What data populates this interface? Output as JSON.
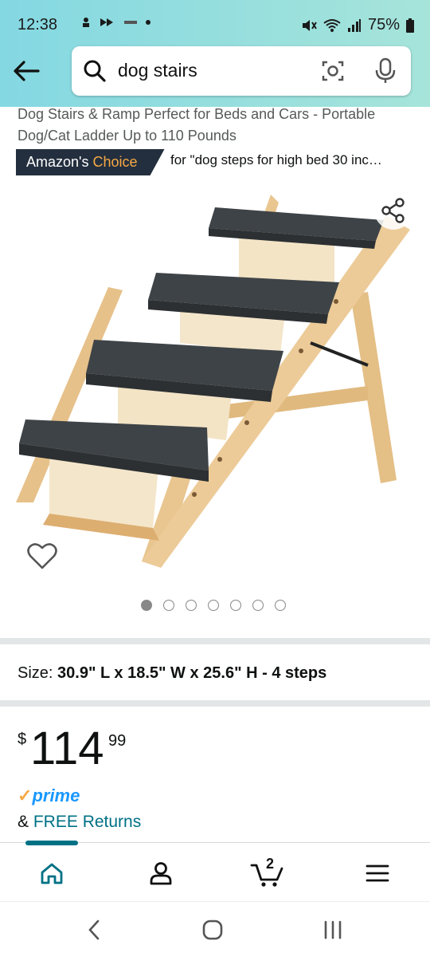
{
  "status_bar": {
    "time": "12:38",
    "battery": "75%"
  },
  "search": {
    "query": "dog stairs"
  },
  "product": {
    "title": "Dog Stairs & Ramp Perfect for Beds and Cars - Portable Dog/Cat Ladder Up to 110 Pounds",
    "badge_prefix": "Amazon's",
    "badge_suffix": "Choice",
    "badge_for": "for \"dog steps for high bed 30 inc…",
    "image_count": 7,
    "active_image_index": 0,
    "size_label": "Size:",
    "size_value": "30.9\" L x 18.5\" W x 25.6\" H - 4 steps",
    "price_symbol": "$",
    "price_whole": "114",
    "price_fraction": "99",
    "prime_label": "prime",
    "returns_prefix": "&",
    "returns_link": "FREE Returns"
  },
  "bottom_nav": {
    "cart_count": "2",
    "items": [
      "home",
      "account",
      "cart",
      "menu"
    ]
  },
  "colors": {
    "header_gradient_start": "#84d8e2",
    "header_gradient_end": "#a6e4da",
    "badge_bg": "#232f3e",
    "badge_accent": "#f7a845",
    "link": "#007185",
    "prime_blue": "#1a98ff"
  }
}
